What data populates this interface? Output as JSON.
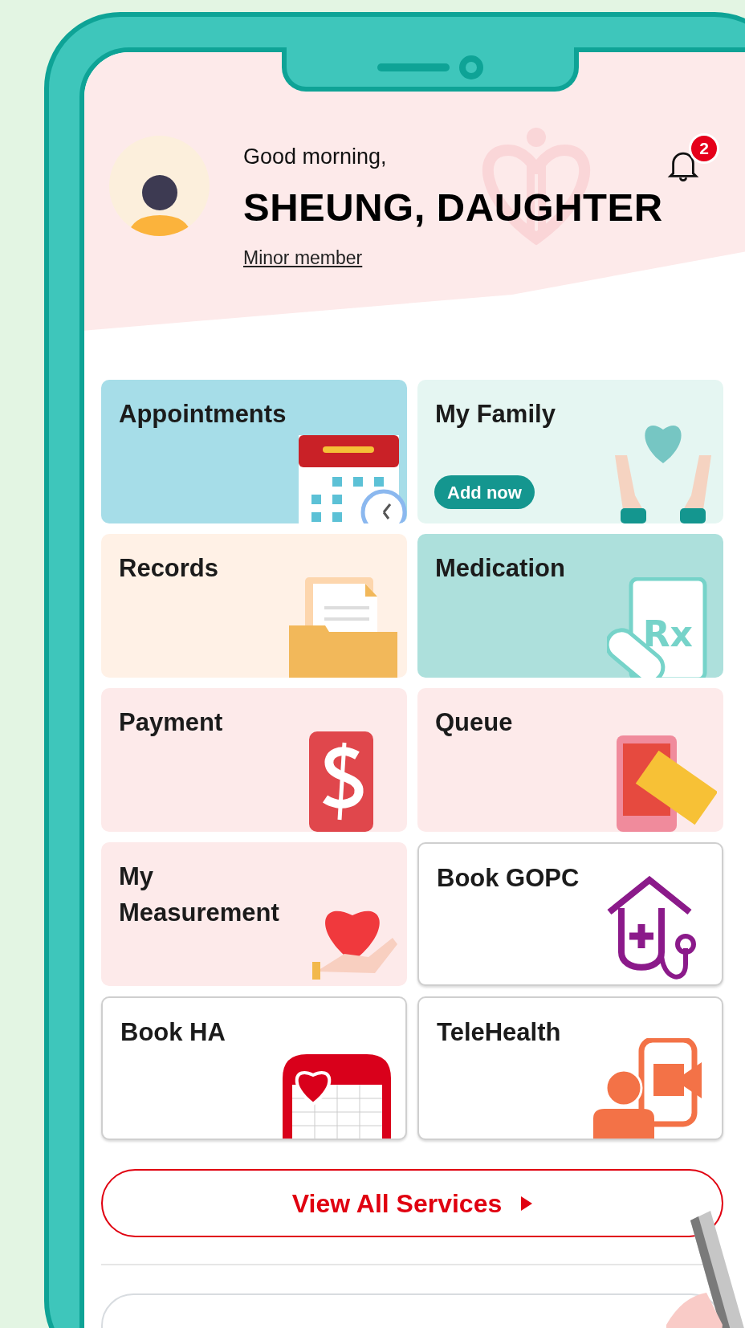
{
  "header": {
    "greeting": "Good morning,",
    "name": "SHEUNG, DAUGHTER",
    "member_link": "Minor member",
    "notifications": {
      "badge": "2"
    }
  },
  "tiles": [
    {
      "label": "Appointments",
      "color": "#a6dde8",
      "outlined": false
    },
    {
      "label": "My Family",
      "color": "#e5f6f2",
      "outlined": false,
      "action": "Add now"
    },
    {
      "label": "Records",
      "color": "#fff1e6",
      "outlined": false
    },
    {
      "label": "Medication",
      "color": "#ade0dc",
      "outlined": false,
      "icon_label": "Rx"
    },
    {
      "label": "Payment",
      "color": "#fdeaea",
      "outlined": false
    },
    {
      "label": "Queue",
      "color": "#fdeaea",
      "outlined": false
    },
    {
      "label": "My Measurement",
      "color": "#fdeaea",
      "outlined": false
    },
    {
      "label": "Book GOPC",
      "color": "#ffffff",
      "outlined": true
    },
    {
      "label": "Book HA",
      "color": "#ffffff",
      "outlined": true
    },
    {
      "label": "TeleHealth",
      "color": "#ffffff",
      "outlined": true
    }
  ],
  "view_all_button": {
    "label": "View All Services"
  }
}
